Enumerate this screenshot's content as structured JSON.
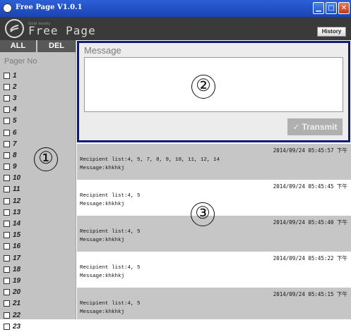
{
  "window": {
    "title": "Free Page V1.0.1"
  },
  "header": {
    "logo_small": "Gold mostly",
    "logo_name": "Free Page",
    "history_label": "History"
  },
  "sidebar": {
    "tabs": [
      "ALL",
      "DEL"
    ],
    "pager_header": "Pager No",
    "pagers": [
      "1",
      "2",
      "3",
      "4",
      "5",
      "6",
      "7",
      "8",
      "9",
      "10",
      "11",
      "12",
      "13",
      "14",
      "15",
      "16",
      "17",
      "18",
      "19",
      "20",
      "21",
      "22",
      "23"
    ]
  },
  "message": {
    "label": "Message",
    "value": "",
    "transmit_label": "Transmit"
  },
  "history": [
    {
      "timestamp": "2014/09/24 05:45:57 下午",
      "recipients": "Recipient list:4, 5, 7, 8, 9, 10, 11, 12, 14",
      "message": "Message:khkhkj"
    },
    {
      "timestamp": "2014/09/24 05:45:45 下午",
      "recipients": "Recipient list:4, 5",
      "message": "Message:khkhkj"
    },
    {
      "timestamp": "2014/09/24 05:45:40 下午",
      "recipients": "Recipient list:4, 5",
      "message": "Message:khkhkj"
    },
    {
      "timestamp": "2014/09/24 05:45:22 下午",
      "recipients": "Recipient list:4, 5",
      "message": "Message:khkhkj"
    },
    {
      "timestamp": "2014/09/24 05:45:15 下午",
      "recipients": "Recipient list:4, 5",
      "message": "Message:khkhkj"
    }
  ],
  "annotations": [
    "①",
    "②",
    "③"
  ]
}
